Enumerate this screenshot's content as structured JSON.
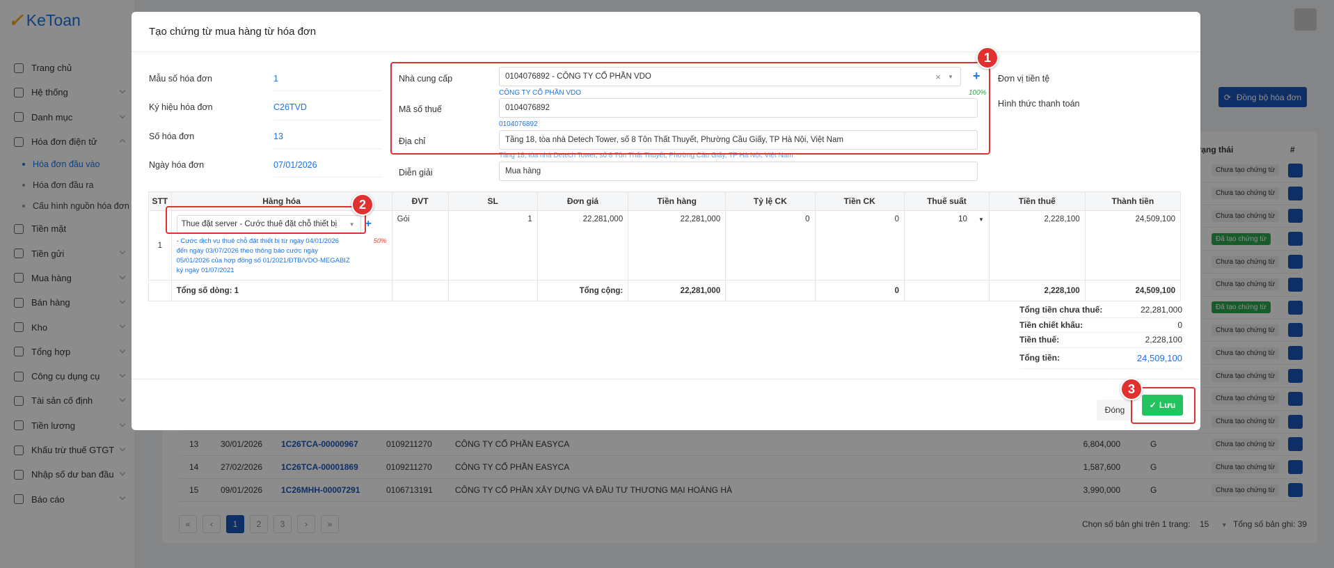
{
  "app": {
    "logo_mark": "✓",
    "logo_text": "KeToan"
  },
  "sidebar": {
    "items": [
      {
        "label": "Trang chủ",
        "icon": "home-icon",
        "chev": false
      },
      {
        "label": "Hệ thống",
        "icon": "gear-icon",
        "chev": true
      },
      {
        "label": "Danh mục",
        "icon": "grid-icon",
        "chev": true
      },
      {
        "label": "Hóa đơn điện tử",
        "icon": "invoice-icon",
        "chev": true
      }
    ],
    "subitems": [
      "Hóa đơn đầu vào",
      "Hóa đơn đầu ra",
      "Cấu hình nguồn hóa đơn"
    ],
    "items2": [
      {
        "label": "Tiền mặt",
        "icon": "cash-icon"
      },
      {
        "label": "Tiền gửi",
        "icon": "bank-icon"
      },
      {
        "label": "Mua hàng",
        "icon": "cart-icon"
      },
      {
        "label": "Bán hàng",
        "icon": "sale-icon"
      },
      {
        "label": "Kho",
        "icon": "warehouse-icon"
      },
      {
        "label": "Tổng hợp",
        "icon": "chart-icon"
      },
      {
        "label": "Công cụ dụng cụ",
        "icon": "tools-icon"
      },
      {
        "label": "Tài sản cố định",
        "icon": "asset-icon"
      },
      {
        "label": "Tiền lương",
        "icon": "salary-icon"
      },
      {
        "label": "Khấu trừ thuế GTGT",
        "icon": "tax-icon"
      },
      {
        "label": "Nhập số dư ban đầu",
        "icon": "import-icon"
      },
      {
        "label": "Báo cáo",
        "icon": "report-icon"
      }
    ]
  },
  "background": {
    "sync_button": "Đồng bộ hóa đơn",
    "col_status": "Trạng thái",
    "col_hash": "#",
    "status_rows": [
      "Chưa tạo chứng từ",
      "Chưa tạo chứng từ",
      "Chưa tạo chứng từ",
      "Đã tạo chứng từ",
      "Chưa tạo chứng từ",
      "Chưa tạo chứng từ",
      "Đã tạo chứng từ",
      "Chưa tạo chứng từ",
      "Chưa tạo chứng từ",
      "Chưa tạo chứng từ",
      "Chưa tạo chứng từ",
      "Chưa tạo chứng từ"
    ],
    "rows": [
      {
        "stt": "13",
        "date": "30/01/2026",
        "invoice": "1C26TCA-00000967",
        "tax": "0109211270",
        "name": "CÔNG TY CỔ PHẦN EASYCA",
        "amount": "6,804,000",
        "type": "G",
        "status": "Chưa tạo chứng từ"
      },
      {
        "stt": "14",
        "date": "27/02/2026",
        "invoice": "1C26TCA-00001869",
        "tax": "0109211270",
        "name": "CÔNG TY CỔ PHẦN EASYCA",
        "amount": "1,587,600",
        "type": "G",
        "status": "Chưa tạo chứng từ"
      },
      {
        "stt": "15",
        "date": "09/01/2026",
        "invoice": "1C26MHH-00007291",
        "tax": "0106713191",
        "name": "CÔNG TY CỔ PHẦN XÂY DỰNG VÀ ĐẦU TƯ THƯƠNG MẠI HOÀNG HÀ",
        "amount": "3,990,000",
        "type": "G",
        "status": "Chưa tạo chứng từ"
      }
    ],
    "pages": [
      "«",
      "‹",
      "1",
      "2",
      "3",
      "›",
      "»"
    ],
    "page_info": "Chọn số bản ghi trên 1 trang:",
    "page_size": "15",
    "total_records": "Tổng số bản ghi:  39"
  },
  "modal": {
    "title": "Tạo chứng từ mua hàng từ hóa đơn",
    "left": [
      {
        "label": "Mẫu số hóa đơn",
        "value": "1"
      },
      {
        "label": "Ký hiệu hóa đơn",
        "value": "C26TVD"
      },
      {
        "label": "Số hóa đơn",
        "value": "13"
      },
      {
        "label": "Ngày hóa đơn",
        "value": "07/01/2026"
      }
    ],
    "supplier_label": "Nhà cung cấp",
    "supplier_value": "0104076892 - CÔNG TY CỔ PHẦN VDO",
    "supplier_hint": "CÔNG TY CỔ PHẦN VDO",
    "supplier_match": "100%",
    "tax_label": "Mã số thuế",
    "tax_value": "0104076892",
    "tax_hint": "0104076892",
    "address_label": "Địa chỉ",
    "address_value": "Tầng 18, tòa nhà Detech Tower, số 8 Tôn Thất Thuyết, Phường Cầu Giấy, TP Hà Nội, Việt Nam",
    "address_hint": "Tầng 18, tòa nhà Detech Tower, số 8 Tôn Thất Thuyết, Phường Cầu Giấy, TP Hà Nội, Việt Nam",
    "desc_label": "Diễn giải",
    "desc_value": "Mua hàng",
    "currency_label": "Đơn vị tiền tệ",
    "payment_label": "Hình thức thanh toán",
    "table": {
      "headers": [
        "STT",
        "Hàng hóa",
        "ĐVT",
        "SL",
        "Đơn giá",
        "Tiền hàng",
        "Tỷ lệ CK",
        "Tiền CK",
        "Thuế suất",
        "Tiền thuế",
        "Thành tiền"
      ],
      "row": {
        "stt": "1",
        "item": "Thue đặt server - Cước thuê đặt chỗ thiết bị",
        "item_desc": "- Cước dịch vụ thuê chỗ đặt thiết bị từ ngày 04/01/2026 đến ngày 03/07/2026 theo thông báo cước ngày 05/01/2026 của hợp đồng số 01/2021/ĐTB/VDO-MEGABIZ ký ngày 01/07/2021",
        "item_match": "50%",
        "unit": "Gói",
        "qty": "1",
        "price": "22,281,000",
        "amount": "22,281,000",
        "ck_rate": "0",
        "ck_amount": "0",
        "vat": "10",
        "vat_amount": "2,228,100",
        "total": "24,509,100"
      },
      "summary": {
        "rows_label": "Tổng số dòng: 1",
        "total_label": "Tổng cộng:",
        "amount": "22,281,000",
        "ck": "0",
        "vat": "2,228,100",
        "total": "24,509,100"
      }
    },
    "totals": [
      {
        "label": "Tổng tiền chưa thuế:",
        "value": "22,281,000"
      },
      {
        "label": "Tiền chiết khấu:",
        "value": "0"
      },
      {
        "label": "Tiền thuế:",
        "value": "2,228,100"
      }
    ],
    "grand_label": "Tổng tiền:",
    "grand_value": "24,509,100",
    "close_button": "Đóng",
    "save_button": "Lưu"
  },
  "annotations": [
    "1",
    "2",
    "3"
  ],
  "colors": {
    "accent": "#1a73e8",
    "primary_dark": "#1a56b8",
    "success": "#22c35e",
    "annotation": "#e03030"
  }
}
